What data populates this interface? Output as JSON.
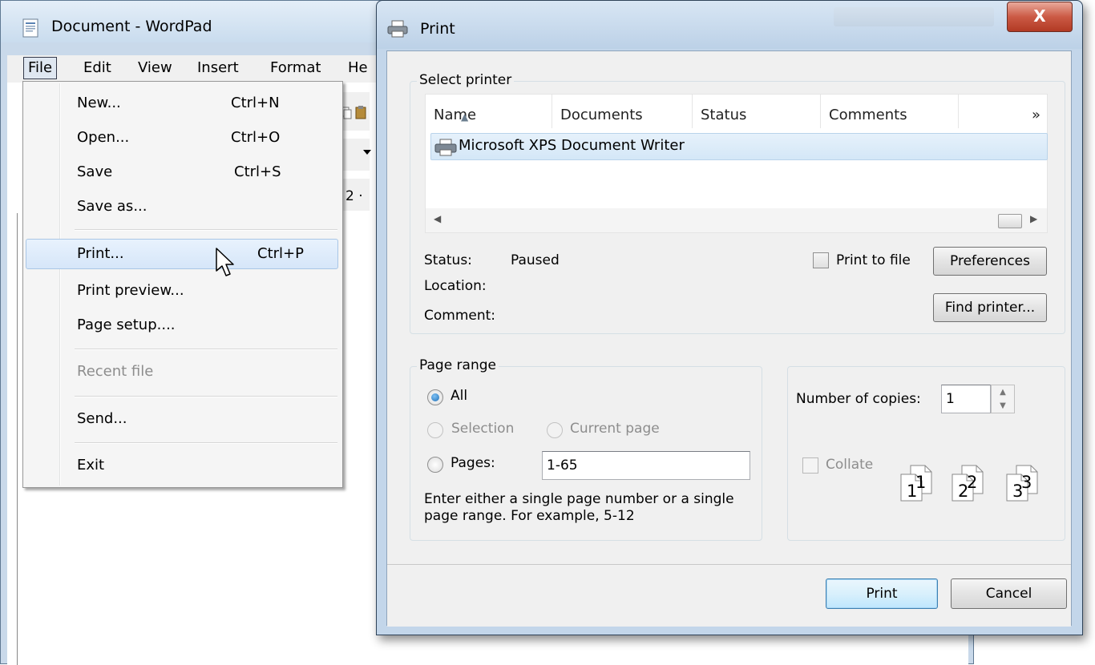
{
  "wordpad": {
    "title": "Document - WordPad",
    "menu": [
      "File",
      "Edit",
      "View",
      "Insert",
      "Format",
      "He"
    ],
    "ruler_fragment": "2 ·"
  },
  "file_menu": {
    "items": [
      {
        "label": "New...",
        "shortcut": "Ctrl+N"
      },
      {
        "label": "Open...",
        "shortcut": "Ctrl+O"
      },
      {
        "label": "Save",
        "shortcut": "Ctrl+S"
      },
      {
        "label": "Save as...",
        "shortcut": ""
      },
      {
        "label": "Print...",
        "shortcut": "Ctrl+P"
      },
      {
        "label": "Print preview...",
        "shortcut": ""
      },
      {
        "label": "Page setup....",
        "shortcut": ""
      },
      {
        "label": "Recent file",
        "shortcut": ""
      },
      {
        "label": "Send...",
        "shortcut": ""
      },
      {
        "label": "Exit",
        "shortcut": ""
      }
    ]
  },
  "print_dialog": {
    "title": "Print",
    "close_glyph": "X",
    "select_printer": {
      "group_title": "Select printer",
      "columns": [
        "Name",
        "Documents",
        "Status",
        "Comments",
        "»"
      ],
      "printers": [
        "Microsoft XPS Document Writer"
      ],
      "status_label": "Status:",
      "status_value": "Paused",
      "location_label": "Location:",
      "comment_label": "Comment:",
      "print_to_file_label": "Print to file",
      "preferences_button": "Preferences",
      "find_printer_button": "Find printer..."
    },
    "page_range": {
      "group_title": "Page range",
      "all_label": "All",
      "selection_label": "Selection",
      "current_page_label": "Current page",
      "pages_label": "Pages:",
      "pages_value": "1-65",
      "hint_line1": "Enter either a single page number or a single",
      "hint_line2": "page range.  For example, 5-12"
    },
    "copies": {
      "label": "Number of copies:",
      "value": "1",
      "collate_label": "Collate",
      "collate_icons": [
        "1",
        "1",
        "2",
        "2",
        "3",
        "3"
      ]
    },
    "buttons": {
      "print": "Print",
      "cancel": "Cancel"
    }
  }
}
